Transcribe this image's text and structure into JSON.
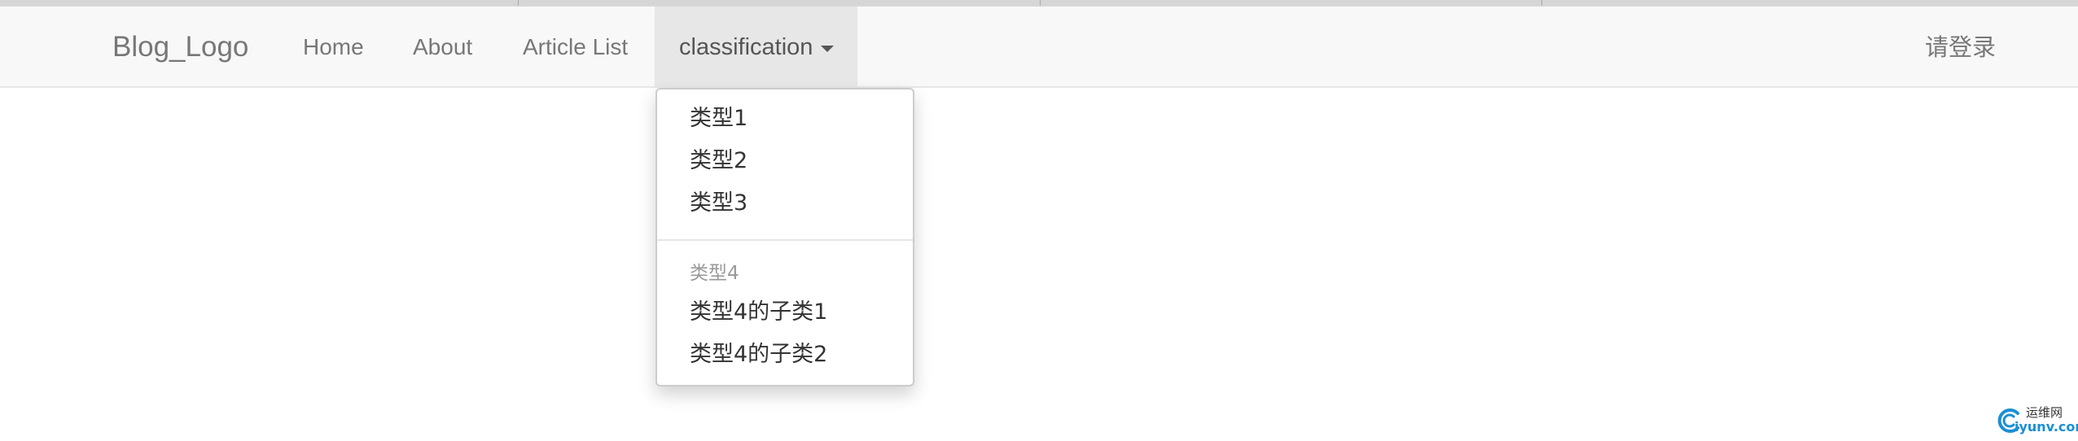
{
  "navbar": {
    "brand": "Blog_Logo",
    "links": [
      "Home",
      "About",
      "Article List"
    ],
    "active_dropdown": "classification",
    "login": "请登录"
  },
  "dropdown": {
    "items": [
      "类型1",
      "类型2",
      "类型3"
    ],
    "header": "类型4",
    "sub_items": [
      "类型4的子类1",
      "类型4的子类2"
    ]
  },
  "watermark": {
    "cn": "运维网",
    "en": "iyunv.com"
  },
  "colors": {
    "navbar_bg": "#f8f8f8",
    "active_tab_bg": "#e7e7e7",
    "link_text": "#777777",
    "dropdown_text": "#333333",
    "header_text": "#999999",
    "watermark_blue": "#1a8fd6"
  }
}
